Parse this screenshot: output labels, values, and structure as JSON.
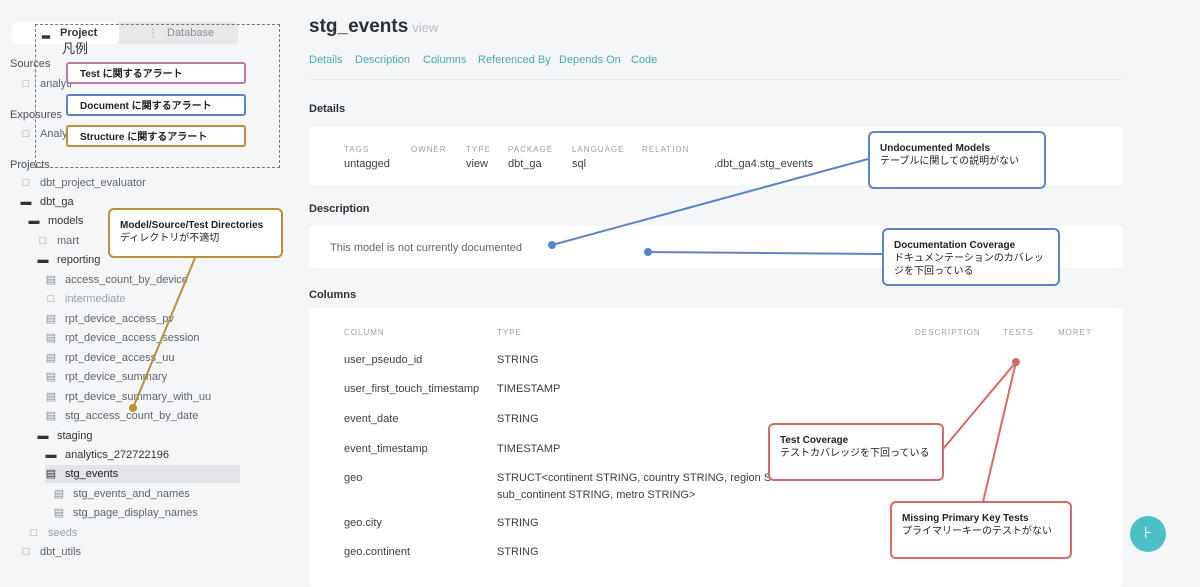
{
  "sidebar": {
    "tabs": [
      {
        "label": "Project",
        "icon": "folder-icon"
      },
      {
        "label": "Database",
        "icon": "database-icon"
      }
    ],
    "sections": {
      "sources": "Sources",
      "sources_item": "analyti",
      "exposures": "Exposures",
      "exposures_item": "Analys",
      "projects": "Projects"
    },
    "tree": [
      {
        "label": "dbt_project_evaluator"
      },
      {
        "label": "dbt_ga"
      },
      {
        "label": "models"
      },
      {
        "label": "mart"
      },
      {
        "label": "reporting"
      },
      {
        "label": "access_count_by_device"
      },
      {
        "label": "intermediate"
      },
      {
        "label": "rpt_device_access_pv"
      },
      {
        "label": "rpt_device_access_session"
      },
      {
        "label": "rpt_device_access_uu"
      },
      {
        "label": "rpt_device_summary"
      },
      {
        "label": "rpt_device_summary_with_uu"
      },
      {
        "label": "stg_access_count_by_date"
      },
      {
        "label": "staging"
      },
      {
        "label": "analytics_272722196"
      },
      {
        "label": "stg_events"
      },
      {
        "label": "stg_events_and_names"
      },
      {
        "label": "stg_page_display_names"
      },
      {
        "label": "seeds"
      },
      {
        "label": "dbt_utils"
      }
    ]
  },
  "header": {
    "title": "stg_events",
    "subtitle": "view",
    "nav": [
      "Details",
      "Description",
      "Columns",
      "Referenced By",
      "Depends On",
      "Code"
    ]
  },
  "details": {
    "heading": "Details",
    "captions": [
      "TAGS",
      "OWNER",
      "TYPE",
      "PACKAGE",
      "LANGUAGE",
      "RELATION"
    ],
    "tags": "untagged",
    "type": "view",
    "package": "dbt_ga",
    "language": "sql",
    "relation": ".dbt_ga4.stg_events"
  },
  "description": {
    "heading": "Description",
    "text": "This model is not currently documented"
  },
  "columns": {
    "heading": "Columns",
    "headers": [
      "COLUMN",
      "TYPE",
      "DESCRIPTION",
      "TESTS",
      "MORE?"
    ],
    "rows": [
      {
        "name": "user_pseudo_id",
        "type": "STRING"
      },
      {
        "name": "user_first_touch_timestamp",
        "type": "TIMESTAMP"
      },
      {
        "name": "event_date",
        "type": "STRING"
      },
      {
        "name": "event_timestamp",
        "type": "TIMESTAMP"
      },
      {
        "name": "geo",
        "type": "STRUCT<continent STRING, country STRING, region STRIN",
        "type2": "sub_continent STRING, metro STRING>"
      },
      {
        "name": "geo.city",
        "type": "STRING"
      },
      {
        "name": "geo.continent",
        "type": "STRING"
      }
    ]
  },
  "legend": {
    "title": "凡例",
    "items": [
      {
        "label": "Test に関するアラート",
        "color": "#c17a9f"
      },
      {
        "label": "Document に関するアラート",
        "color": "#5b84c8"
      },
      {
        "label": "Structure に関するアラート",
        "color": "#b9903b"
      }
    ]
  },
  "notes": {
    "dirs": {
      "title": "Model/Source/Test Directories",
      "body": "ディレクトリが不適切",
      "color": "#b9903b"
    },
    "undoc": {
      "title": "Undocumented Models",
      "body": "テーブルに関しての説明がない",
      "color": "#5b84c8"
    },
    "doccov": {
      "title": "Documentation Coverage",
      "body": "ドキュメンテーションのカバレッジを下回っている",
      "color": "#5b84c8"
    },
    "testcov": {
      "title": "Test Coverage",
      "body": "テストカバレッジを下回っている",
      "color": "#d46a6a"
    },
    "pk": {
      "title": "Missing Primary Key Tests",
      "body": "プライマリーキーのテストがない",
      "color": "#d46a6a"
    }
  },
  "fab": {
    "icon": "lineage-icon"
  }
}
